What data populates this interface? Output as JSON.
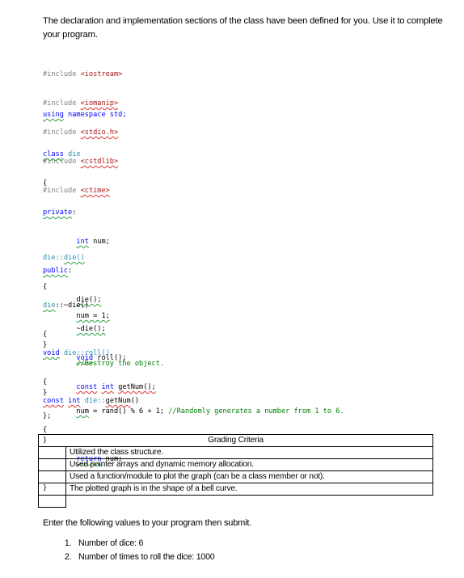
{
  "intro": "The declaration and implementation sections of the class have been defined for you. Use it to complete your program.",
  "code": {
    "includes": [
      {
        "directive": "#include",
        "header": "<iostream>"
      },
      {
        "directive": "#include",
        "header": "<iomanip>"
      },
      {
        "directive": "#include",
        "header": "<stdio.h>"
      },
      {
        "directive": "#include",
        "header": "<cstdlib>"
      },
      {
        "directive": "#include",
        "header": "<ctime>"
      }
    ],
    "using_kw": "using",
    "using_rest": " namespace std;",
    "class_kw": "class",
    "class_name": " die",
    "open_brace": "{",
    "close_brace": "}",
    "close_class": "};",
    "private": "private",
    "colon": ":",
    "int_kw": "int",
    "num_decl": " num;",
    "public": "public",
    "ctor_decl": "die();",
    "dtor_decl": "~die();",
    "void_kw": "void",
    "roll_decl": " roll();",
    "const_kw": "const",
    "getnum_decl": "getNum();",
    "ctor_def_prefix": "die::",
    "ctor_def_name": "die()",
    "ctor_body": "num = 1;",
    "dtor_def_prefix": "die",
    "dtor_def_rest": "::~die()",
    "dtor_comment": "//Destroy the object.",
    "roll_def_rest": " die::roll()",
    "roll_body_var": "num",
    "roll_body_rest": " = rand() % 6 + 1; ",
    "roll_comment": "//Randomly generates a number from 1 to 6.",
    "getnum_def_prefix": " die::",
    "getnum_def_name": "getNum",
    "getnum_def_rest": "()",
    "return_kw": "return",
    "return_rest": " num;"
  },
  "grading": {
    "title": "Grading Criteria",
    "criteria": [
      "Utilized the class structure.",
      "Used pointer arrays and dynamic memory allocation.",
      "Used a function/module to plot the graph (can be a class member or not).",
      "The plotted graph is in the shape of a bell curve."
    ]
  },
  "instructions": "Enter the following values to your program then submit.",
  "values": [
    "Number of dice: 6",
    "Number of times to roll the dice: 1000"
  ]
}
